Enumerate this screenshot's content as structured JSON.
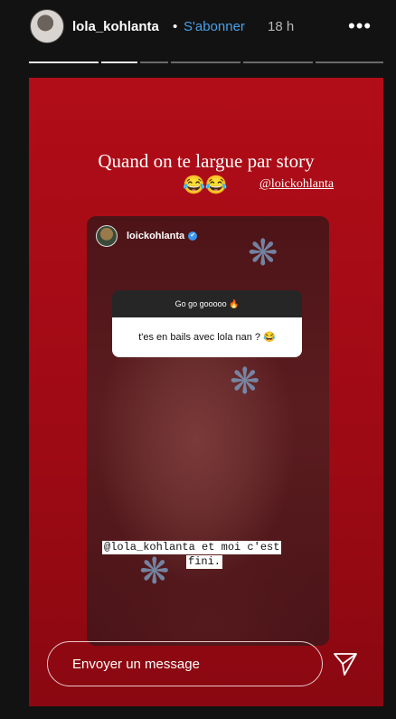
{
  "header": {
    "username": "lola_kohlanta",
    "separator": "•",
    "follow_label": "S'abonner",
    "time": "18 h",
    "more_icon": "more-options-icon"
  },
  "story": {
    "caption": "Quand on te largue par story",
    "emojis": "😂😂",
    "mention": "@loickohlanta",
    "card": {
      "username": "loickohlanta",
      "verified": "✔",
      "question_title": "Go go gooooo 🔥",
      "question_text": "t'es en bails avec lola nan ? 😂",
      "overlay_line1": "@lola_kohlanta et moi c'est",
      "overlay_line2": "fini."
    }
  },
  "message_bar": {
    "placeholder": "Envoyer un message",
    "send_icon": "send-icon"
  },
  "colors": {
    "story_red": "#b10d18",
    "follow_blue": "#4a9fe8"
  }
}
